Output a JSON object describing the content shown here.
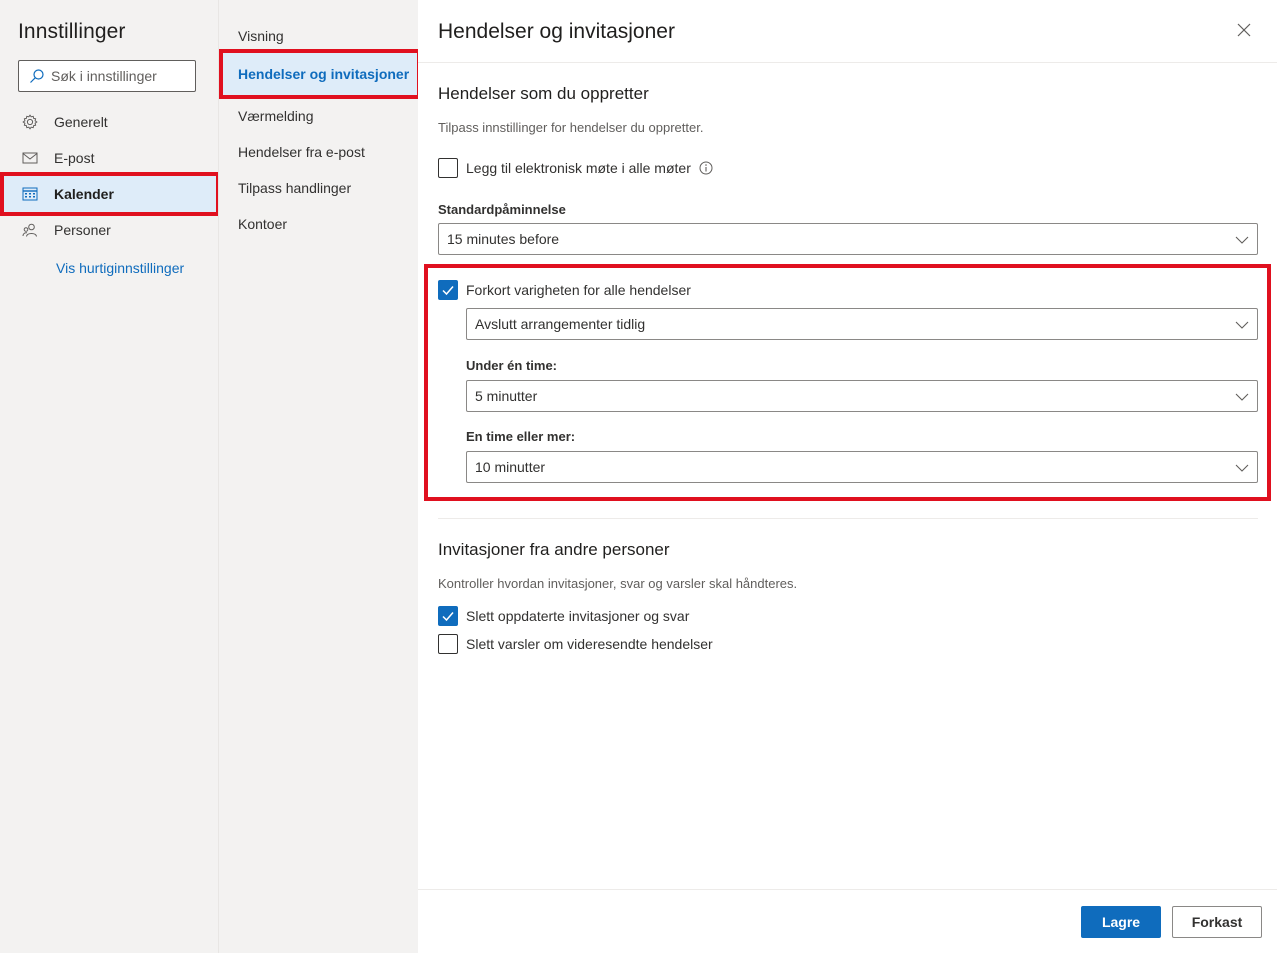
{
  "app": {
    "title": "Innstillinger",
    "search": {
      "placeholder": "Søk i innstillinger",
      "icon": "search-icon"
    }
  },
  "nav": {
    "items": [
      {
        "label": "Generelt",
        "icon": "gear-icon"
      },
      {
        "label": "E-post",
        "icon": "mail-icon"
      },
      {
        "label": "Kalender",
        "icon": "calendar-icon",
        "selected": true
      },
      {
        "label": "Personer",
        "icon": "people-icon"
      }
    ],
    "quick_settings": "Vis hurtiginnstillinger"
  },
  "subnav": {
    "items": [
      {
        "label": "Visning"
      },
      {
        "label": "Hendelser og invitasjoner",
        "selected": true
      },
      {
        "label": "Værmelding"
      },
      {
        "label": "Hendelser fra e-post"
      },
      {
        "label": "Tilpass handlinger"
      },
      {
        "label": "Kontoer"
      }
    ]
  },
  "main": {
    "title": "Hendelser og invitasjoner",
    "close_icon": "close-icon",
    "section1": {
      "title": "Hendelser som du oppretter",
      "description": "Tilpass innstillinger for hendelser du oppretter.",
      "online_meeting": {
        "label": "Legg til elektronisk møte i alle møter",
        "checked": false
      },
      "reminder": {
        "label": "Standardpåminnelse",
        "value": "15 minutes before"
      },
      "shorten": {
        "label": "Forkort varigheten for alle hendelser",
        "checked": true
      },
      "shorten_mode": {
        "value": "Avslutt arrangementer tidlig"
      },
      "under_hour": {
        "label": "Under én time:",
        "value": "5 minutter"
      },
      "over_hour": {
        "label": "En time eller mer:",
        "value": "10 minutter"
      }
    },
    "section2": {
      "title": "Invitasjoner fra andre personer",
      "description": "Kontroller hvordan invitasjoner, svar og varsler skal håndteres.",
      "delete_updated": {
        "label": "Slett oppdaterte invitasjoner og svar",
        "checked": true
      },
      "delete_forward": {
        "label": "Slett varsler om videresendte hendelser",
        "checked": false
      }
    }
  },
  "footer": {
    "save": "Lagre",
    "discard": "Forkast"
  },
  "colors": {
    "accent": "#0f6cbd",
    "selected_bg": "#deecf9",
    "highlight": "#e0101f"
  }
}
